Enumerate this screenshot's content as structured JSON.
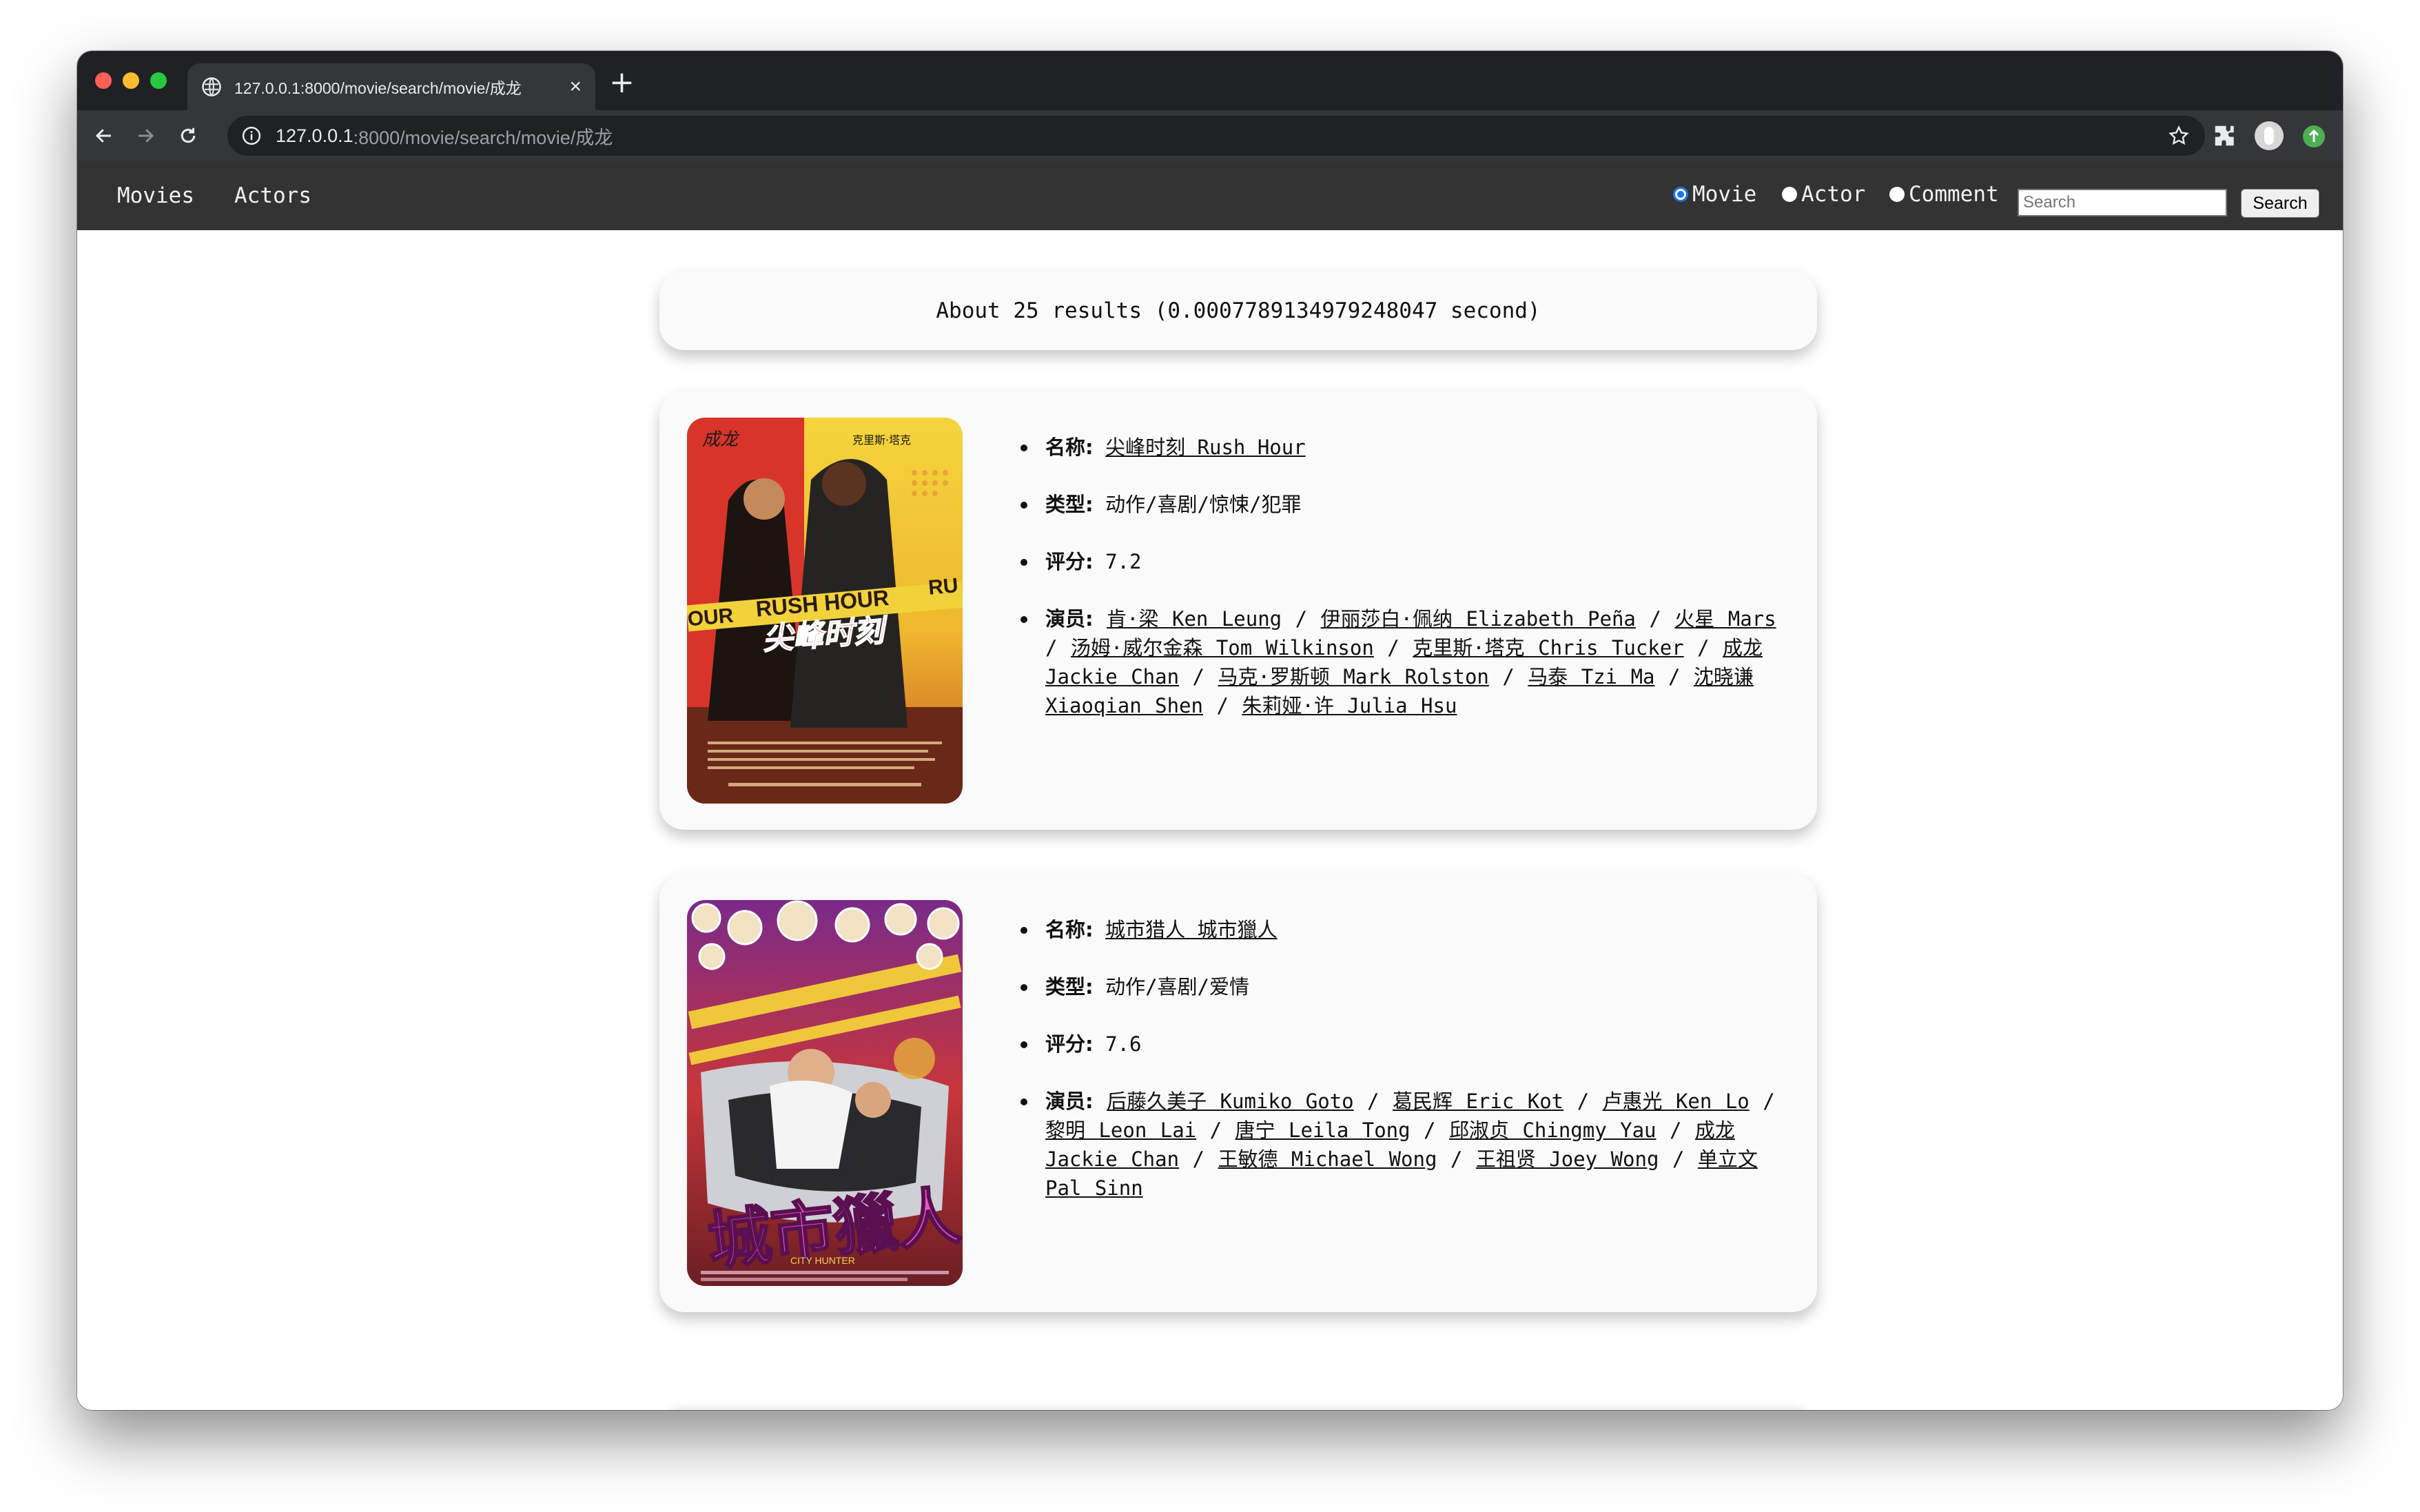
{
  "browser": {
    "tab_title": "127.0.0.1:8000/movie/search/movie/成龙",
    "url_host": "127.0.0.1",
    "url_path": ":8000/movie/search/movie/成龙"
  },
  "navbar": {
    "links": [
      "Movies",
      "Actors"
    ],
    "search_options": [
      {
        "label": "Movie",
        "checked": true
      },
      {
        "label": "Actor",
        "checked": false
      },
      {
        "label": "Comment",
        "checked": false
      }
    ],
    "search_placeholder": "Search",
    "search_button": "Search"
  },
  "results_summary": "About 25 results (0.0007789134979248047 second)",
  "movies": [
    {
      "name_label": "名称:",
      "name": "尖峰时刻 Rush Hour",
      "genre_label": "类型:",
      "genre": "动作/喜剧/惊悚/犯罪",
      "rating_label": "评分:",
      "rating": "7.2",
      "actors_label": "演员:",
      "actors": [
        "肯·梁 Ken Leung",
        "伊丽莎白·佩纳 Elizabeth Peña",
        "火星 Mars",
        "汤姆·威尔金森 Tom Wilkinson",
        "克里斯·塔克 Chris Tucker",
        "成龙 Jackie Chan",
        "马克·罗斯顿 Mark Rolston",
        "马泰 Tzi Ma",
        "沈晓谦 Xiaoqian Shen",
        "朱莉娅·许 Julia Hsu"
      ],
      "poster": {
        "top_left_text": "成龙",
        "top_right_text": "克里斯·塔克",
        "english_title": "RUSH HOUR",
        "side_text_left": "OUR",
        "side_text_right": "RU",
        "chinese_title": "尖峰时刻"
      }
    },
    {
      "name_label": "名称:",
      "name": "城市猎人 城市獵人",
      "genre_label": "类型:",
      "genre": "动作/喜剧/爱情",
      "rating_label": "评分:",
      "rating": "7.6",
      "actors_label": "演员:",
      "actors": [
        "后藤久美子 Kumiko Goto",
        "葛民辉 Eric Kot",
        "卢惠光 Ken Lo",
        "黎明 Leon Lai",
        "唐宁 Leila Tong",
        "邱淑贞 Chingmy Yau",
        "成龙 Jackie Chan",
        "王敏德 Michael Wong",
        "王祖贤 Joey Wong",
        "单立文 Pal Sinn"
      ],
      "poster": {
        "chinese_title": "城市獵人",
        "english_title": "CITY HUNTER"
      }
    }
  ],
  "colors": {
    "navbar_bg": "#333333",
    "tab_bar_bg": "#202124",
    "toolbar_bg": "#35363a",
    "card_bg": "#fafafa",
    "radio_accent": "#1a73e8"
  }
}
